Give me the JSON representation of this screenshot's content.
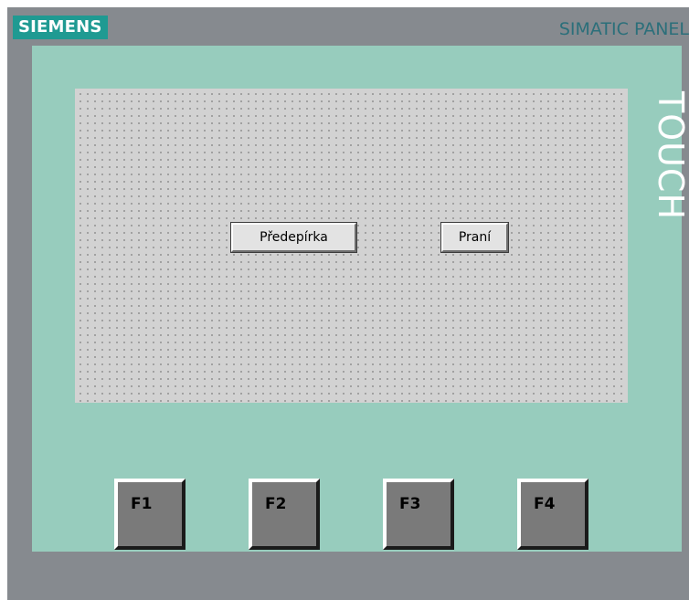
{
  "panel": {
    "logo": "SIEMENS",
    "brand": "SIMATIC PANEL",
    "touch_label": "TOUCH"
  },
  "screen": {
    "buttons": [
      {
        "label": "Předepírka"
      },
      {
        "label": "Praní"
      }
    ]
  },
  "function_keys": [
    {
      "label": "F1"
    },
    {
      "label": "F2"
    },
    {
      "label": "F3"
    },
    {
      "label": "F4"
    }
  ],
  "colors": {
    "housing": "#868a8f",
    "bezel": "#97ccbd",
    "logo_background": "#1f9a92",
    "brand_text": "#2b6f7a",
    "screen_background": "#d2d2d2"
  }
}
